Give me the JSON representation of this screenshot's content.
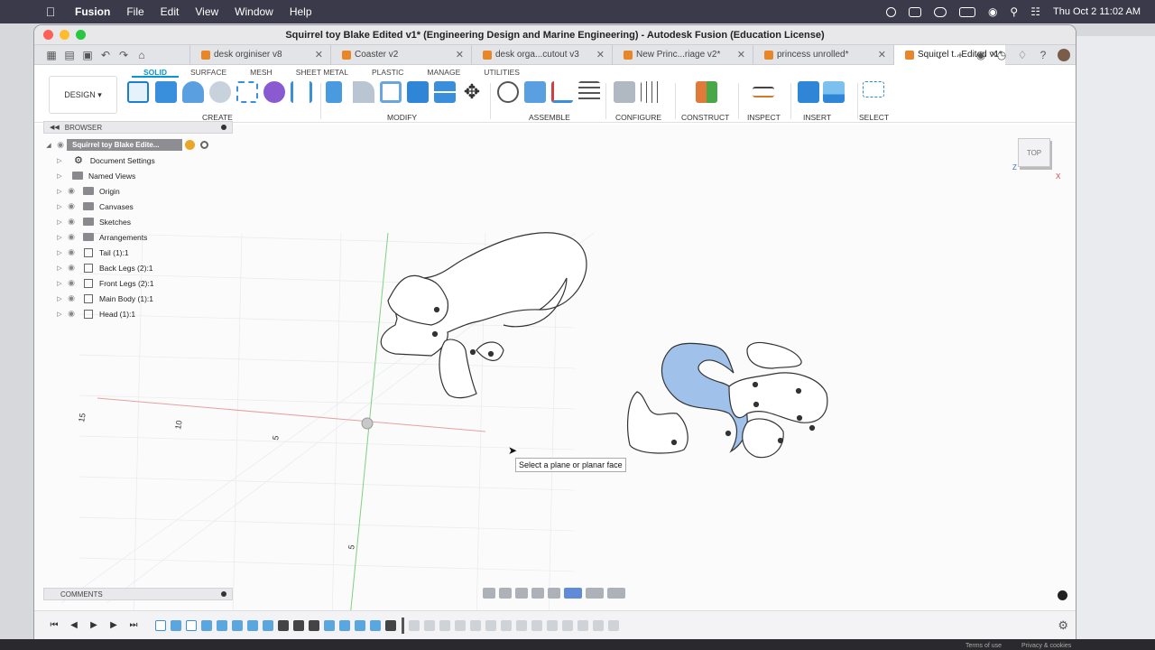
{
  "menubar": {
    "app_name": "Fusion",
    "items": [
      "File",
      "Edit",
      "View",
      "Window",
      "Help"
    ],
    "datetime": "Thu Oct 2  11:02 AM"
  },
  "window": {
    "title": "Squirrel toy Blake Edited v1* (Engineering Design and Marine Engineering) - Autodesk Fusion (Education License)"
  },
  "tabs": [
    {
      "label": "desk orginiser v8",
      "active": false
    },
    {
      "label": "Coaster v2",
      "active": false
    },
    {
      "label": "desk orga...cutout v3",
      "active": false
    },
    {
      "label": "New Princ...riage v2*",
      "active": false
    },
    {
      "label": "princess unrolled*",
      "active": false
    },
    {
      "label": "Squirrel t...Edited v1*",
      "active": true
    }
  ],
  "toolbar": {
    "workspace": "DESIGN",
    "workspace_tabs": [
      "SOLID",
      "SURFACE",
      "MESH",
      "SHEET METAL",
      "PLASTIC",
      "MANAGE",
      "UTILITIES"
    ],
    "groups": [
      "CREATE",
      "MODIFY",
      "ASSEMBLE",
      "CONFIGURE",
      "CONSTRUCT",
      "INSPECT",
      "INSERT",
      "SELECT"
    ]
  },
  "browser": {
    "header": "BROWSER",
    "root": "Squirrel toy Blake Edite...",
    "items": [
      {
        "label": "Document Settings",
        "icon": "gear-icon"
      },
      {
        "label": "Named Views",
        "icon": "folder-icon"
      },
      {
        "label": "Origin",
        "icon": "folder-icon"
      },
      {
        "label": "Canvases",
        "icon": "folder-icon"
      },
      {
        "label": "Sketches",
        "icon": "folder-icon"
      },
      {
        "label": "Arrangements",
        "icon": "folder-icon"
      },
      {
        "label": "Tail (1):1",
        "icon": "component-icon"
      },
      {
        "label": "Back Legs (2):1",
        "icon": "component-icon"
      },
      {
        "label": "Front Legs (2):1",
        "icon": "component-icon"
      },
      {
        "label": "Main Body (1):1",
        "icon": "component-icon"
      },
      {
        "label": "Head (1):1",
        "icon": "component-icon"
      }
    ]
  },
  "comments": {
    "header": "COMMENTS"
  },
  "viewport": {
    "tooltip": "Select a plane or planar face",
    "viewcube_label": "TOP",
    "axis_labels": [
      "15",
      "10",
      "5",
      "5"
    ],
    "highlight_color": "#9fc1ea"
  },
  "bottom": {
    "terms": "Terms of use",
    "privacy": "Privacy & cookies"
  }
}
